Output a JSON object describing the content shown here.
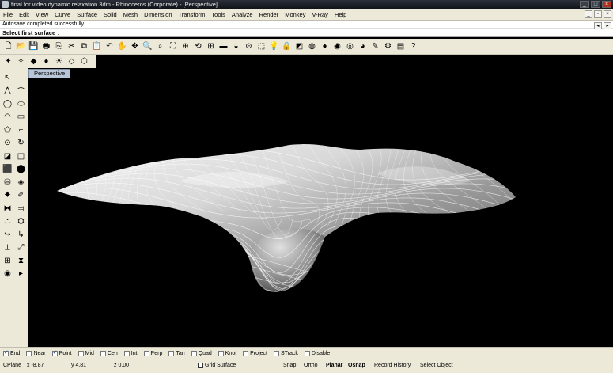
{
  "window": {
    "title": "final for video dynamic relaxation.3dm - Rhinoceros (Corporate) - [Perspective]",
    "controls": [
      "_",
      "□",
      "×"
    ]
  },
  "menu": [
    "File",
    "Edit",
    "View",
    "Curve",
    "Surface",
    "Solid",
    "Mesh",
    "Dimension",
    "Transform",
    "Tools",
    "Analyze",
    "Render",
    "Monkey",
    "V-Ray",
    "Help"
  ],
  "command": {
    "history": "Autosave completed successfully",
    "prompt": "Select first surface"
  },
  "viewport": {
    "tab_label": "Perspective"
  },
  "osnaps": [
    {
      "label": "End",
      "checked": true
    },
    {
      "label": "Near",
      "checked": false
    },
    {
      "label": "Point",
      "checked": true
    },
    {
      "label": "Mid",
      "checked": false
    },
    {
      "label": "Cen",
      "checked": false
    },
    {
      "label": "Int",
      "checked": false
    },
    {
      "label": "Perp",
      "checked": false
    },
    {
      "label": "Tan",
      "checked": false
    },
    {
      "label": "Quad",
      "checked": false
    },
    {
      "label": "Knot",
      "checked": false
    },
    {
      "label": "Project",
      "checked": false
    },
    {
      "label": "STrack",
      "checked": false
    },
    {
      "label": "Disable",
      "checked": false
    }
  ],
  "status": {
    "cplane": "CPlane",
    "x": "x -8.87",
    "y": "y 4.81",
    "z": "z 0.00",
    "layer": "Grid Surface",
    "snap": "Snap",
    "ortho": "Ortho",
    "planar": "Planar",
    "osnap": "Osnap",
    "record": "Record History",
    "hint": "Select Object"
  },
  "colors": {
    "chrome": "#ece9d8",
    "viewport_bg": "#000000",
    "tab_active": "#b8c4d8"
  }
}
